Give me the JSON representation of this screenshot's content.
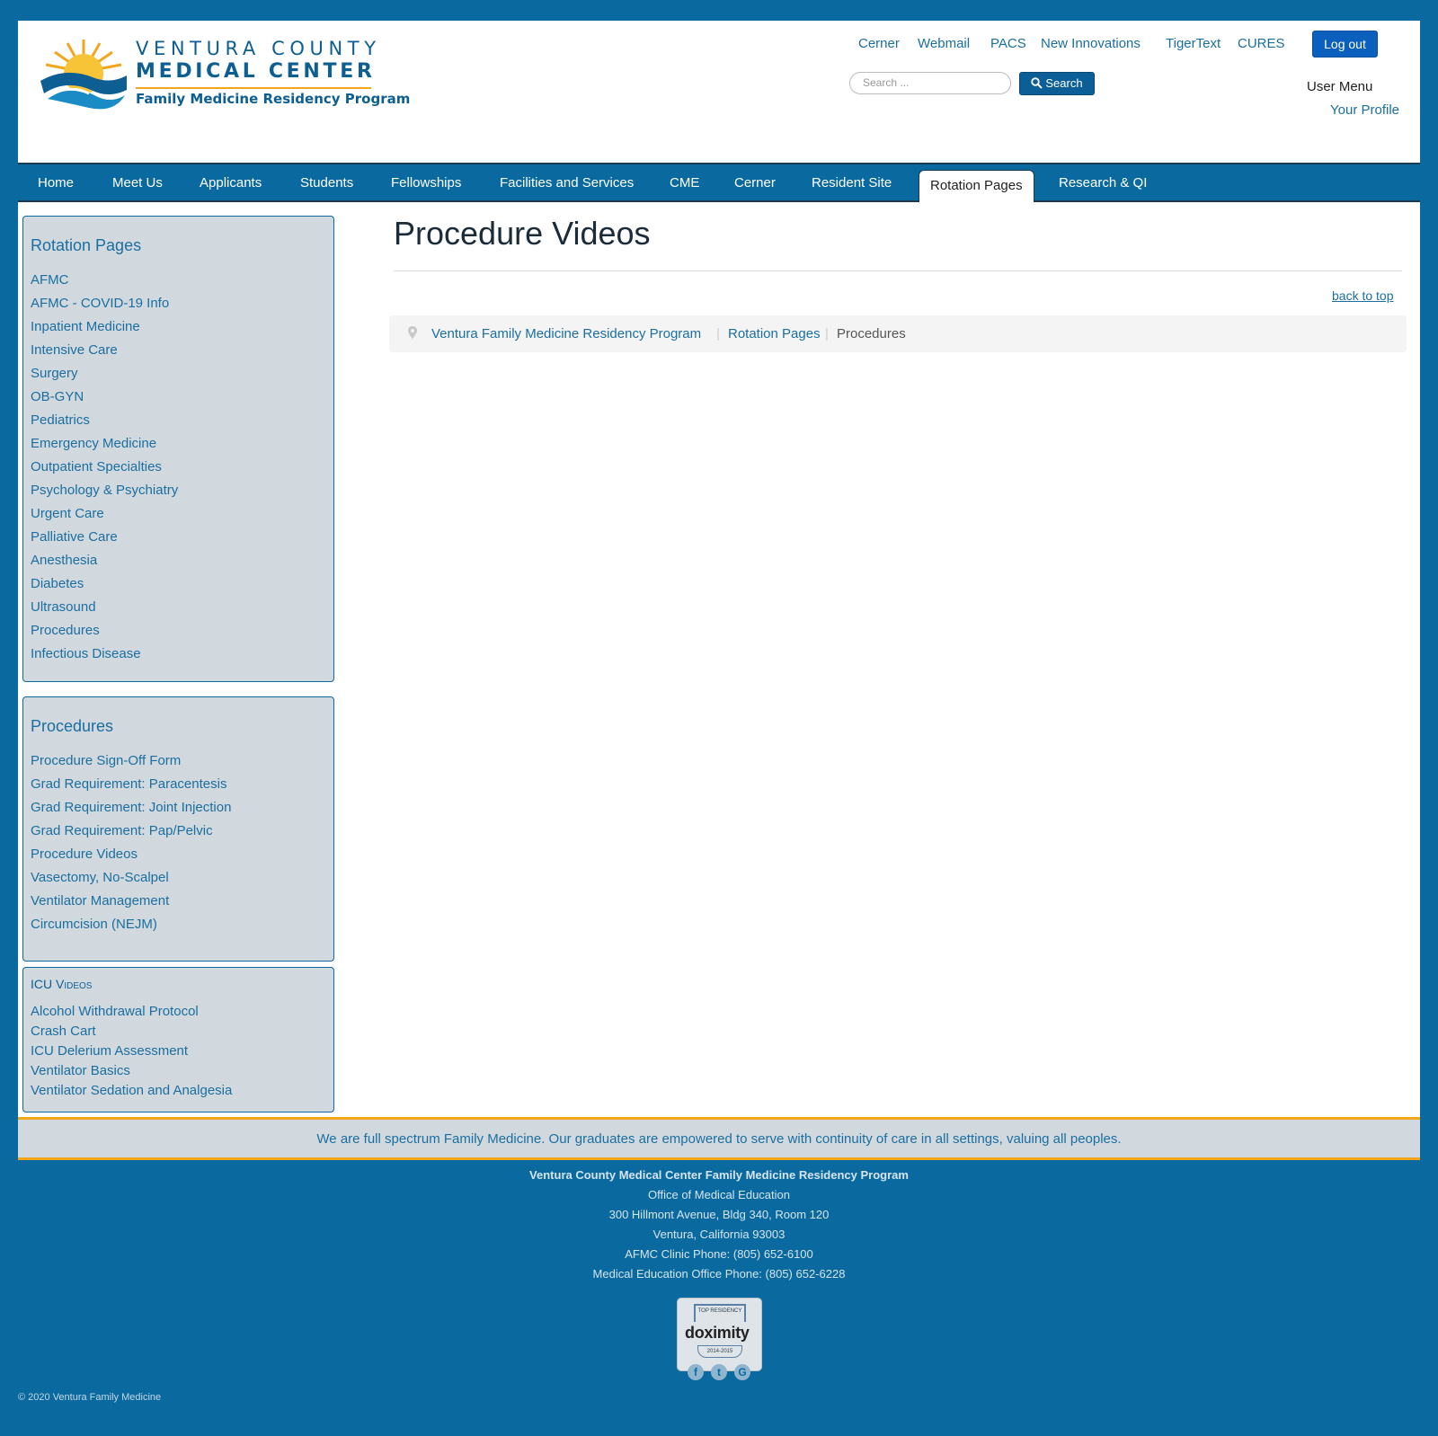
{
  "header": {
    "logo": {
      "line1": "VENTURA COUNTY",
      "line2": "MEDICAL CENTER",
      "line3": "Family Medicine Residency Program"
    },
    "top_links": [
      "Cerner",
      "Webmail",
      "PACS",
      "New Innovations",
      "TigerText",
      "CURES"
    ],
    "logout_label": "Log out",
    "search": {
      "placeholder": "Search ...",
      "button_label": "Search"
    },
    "user_menu": {
      "title": "User Menu",
      "profile_link": "Your Profile"
    }
  },
  "nav": {
    "items": [
      "Home",
      "Meet Us",
      "Applicants",
      "Students",
      "Fellowships",
      "Facilities and Services",
      "CME",
      "Cerner",
      "Resident Site",
      "Rotation Pages",
      "Research & QI"
    ],
    "active": "Rotation Pages"
  },
  "sidebar": {
    "rotation_pages": {
      "title": "Rotation Pages",
      "links": [
        "AFMC",
        "AFMC - COVID-19 Info",
        "Inpatient Medicine",
        "Intensive Care",
        "Surgery",
        "OB-GYN",
        "Pediatrics",
        "Emergency Medicine",
        "Outpatient Specialties",
        "Psychology & Psychiatry",
        "Urgent Care",
        "Palliative Care",
        "Anesthesia",
        "Diabetes",
        "Ultrasound",
        "Procedures",
        "Infectious Disease"
      ]
    },
    "procedures": {
      "title": "Procedures",
      "links": [
        "Procedure Sign-Off Form",
        "Grad Requirement: Paracentesis",
        "Grad Requirement: Joint Injection",
        "Grad Requirement: Pap/Pelvic",
        "Procedure Videos",
        "Vasectomy, No-Scalpel",
        "Ventilator Management",
        "Circumcision (NEJM)"
      ]
    },
    "icu_videos": {
      "title": "ICU Videos",
      "links": [
        "Alcohol Withdrawal Protocol",
        "Crash Cart",
        "ICU Delerium Assessment",
        "Ventilator Basics",
        "Ventilator Sedation and Analgesia"
      ]
    }
  },
  "content": {
    "title": "Procedure Videos",
    "back_to_top": "back to top",
    "breadcrumb": [
      "Ventura Family Medicine Residency Program",
      "Rotation Pages",
      "Procedures"
    ]
  },
  "mission": "We are full spectrum Family Medicine. Our graduates are empowered to serve with continuity of care in all settings, valuing all peoples.",
  "footer": {
    "org": "Ventura County Medical Center Family Medicine Residency Program",
    "office": "Office of Medical Education",
    "address1": "300 Hillmont Avenue, Bldg 340, Room 120",
    "address2": "Ventura, California 93003",
    "phone1": "AFMC Clinic Phone: (805) 652-6100",
    "phone2": "Medical Education Office Phone: (805) 652-6228",
    "badge": {
      "top": "TOP RESIDENCY",
      "brand": "doximity",
      "years": "2014-2015"
    },
    "social_icons": [
      "facebook-icon",
      "twitter-icon",
      "google-icon"
    ],
    "copyright": "© 2020 Ventura Family Medicine"
  },
  "colors": {
    "brand_blue": "#0a6aa0",
    "link_blue": "#1a6ea0",
    "accent_gold": "#f3a51b",
    "sidebar_gray": "#d2d9de",
    "logout_blue": "#0b5fbd"
  }
}
